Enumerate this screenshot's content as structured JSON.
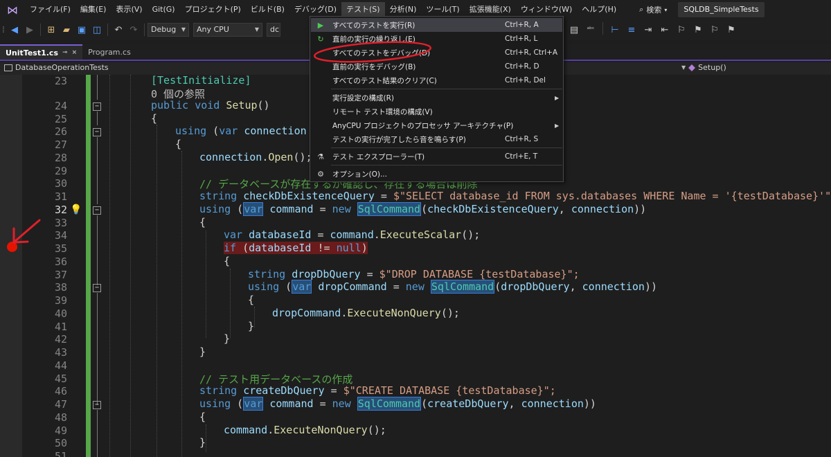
{
  "menubar": {
    "items": [
      "ファイル(F)",
      "編集(E)",
      "表示(V)",
      "Git(G)",
      "プロジェクト(P)",
      "ビルド(B)",
      "デバッグ(D)",
      "テスト(S)",
      "分析(N)",
      "ツール(T)",
      "拡張機能(X)",
      "ウィンドウ(W)",
      "ヘルプ(H)"
    ],
    "search_label": "検索",
    "project_title": "SQLDB_SimpleTests"
  },
  "toolbar": {
    "config": "Debug",
    "platform": "Any CPU",
    "startup_partial": "dc"
  },
  "tabs": [
    {
      "label": "UnitTest1.cs",
      "pin": "⊸",
      "close": "×"
    },
    {
      "label": "Program.cs"
    }
  ],
  "navbar": {
    "class": "DatabaseOperationTests",
    "member": "Setup()"
  },
  "editor": {
    "line_numbers": [
      "23",
      "24",
      "25",
      "26",
      "27",
      "28",
      "29",
      "30",
      "31",
      "32",
      "33",
      "34",
      "35",
      "36",
      "37",
      "38",
      "39",
      "40",
      "41",
      "42",
      "43",
      "44",
      "45",
      "46",
      "47",
      "48",
      "49",
      "50",
      "51"
    ],
    "refs_text": "0 個の参照",
    "attribute": "[TestInitialize]",
    "comment1": "// データベースが存在するか確認し、存在する場合は削除",
    "comment2": "// テスト用データベースの作成",
    "sql_check": "$\"SELECT database_id FROM sys.databases WHERE Name = '{testDatabase}'\";",
    "sql_drop": "$\"DROP DATABASE {testDatabase}\";",
    "sql_create": "$\"CREATE DATABASE {testDatabase}\";"
  },
  "test_menu": {
    "items": [
      {
        "label": "すべてのテストを実行(R)",
        "shortcut": "Ctrl+R, A",
        "icon": "play-icon"
      },
      {
        "label": "直前の実行の繰り返し(E)",
        "shortcut": "Ctrl+R, L",
        "icon": "repeat-icon"
      },
      {
        "label": "すべてのテストをデバッグ(D)",
        "shortcut": "Ctrl+R, Ctrl+A"
      },
      {
        "label": "直前の実行をデバッグ(B)",
        "shortcut": "Ctrl+R, D"
      },
      {
        "label": "すべてのテスト結果のクリア(C)",
        "shortcut": "Ctrl+R, Del"
      },
      {
        "label": "実行設定の構成(R)",
        "submenu": true
      },
      {
        "label": "リモート テスト環境の構成(V)"
      },
      {
        "label": "AnyCPU プロジェクトのプロセッサ アーキテクチャ(P)",
        "submenu": true
      },
      {
        "label": "テストの実行が完了したら音を鳴らす(P)",
        "shortcut": "Ctrl+R, S"
      },
      {
        "label": "テスト エクスプローラー(T)",
        "shortcut": "Ctrl+E, T",
        "icon": "test-explorer-icon"
      },
      {
        "label": "オプション(O)...",
        "icon": "gear-icon"
      }
    ]
  },
  "colors": {
    "accent": "#7a5fd6",
    "breakpoint": "#e51400",
    "annotation": "#e0202a",
    "change_bar": "#57a64a"
  }
}
